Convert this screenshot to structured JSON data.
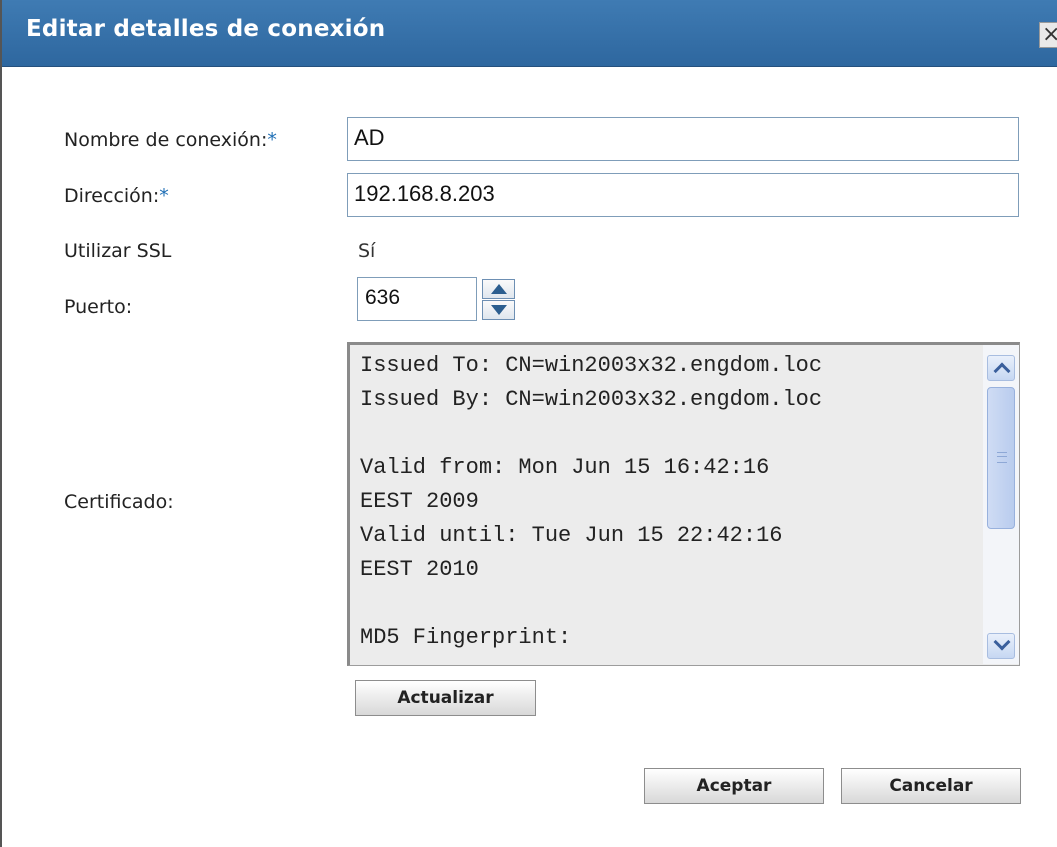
{
  "dialog": {
    "title": "Editar detalles de conexión",
    "close_label": "×"
  },
  "form": {
    "connection_name_label": "Nombre de conexión:",
    "connection_name_value": "AD",
    "address_label": "Dirección:",
    "address_value": "192.168.8.203",
    "ssl_label": "Utilizar SSL",
    "ssl_value": "Sí",
    "port_label": "Puerto:",
    "port_value": "636",
    "required_marker": "*",
    "certificate_label": "Certificado:",
    "certificate_text": "Issued To: CN=win2003x32.engdom.loc\nIssued By: CN=win2003x32.engdom.loc\n\nValid from: Mon Jun 15 16:42:16\nEEST 2009\nValid until: Tue Jun 15 22:42:16\nEEST 2010\n\nMD5 Fingerprint:"
  },
  "buttons": {
    "update": "Actualizar",
    "ok": "Aceptar",
    "cancel": "Cancelar"
  },
  "icons": {
    "close": "close-icon",
    "spin_up": "arrow-up-icon",
    "spin_down": "arrow-down-icon",
    "scroll_up": "chevron-up-icon",
    "scroll_down": "chevron-down-icon"
  },
  "colors": {
    "titlebar": "#3471aa",
    "required": "#1f6fb5"
  }
}
